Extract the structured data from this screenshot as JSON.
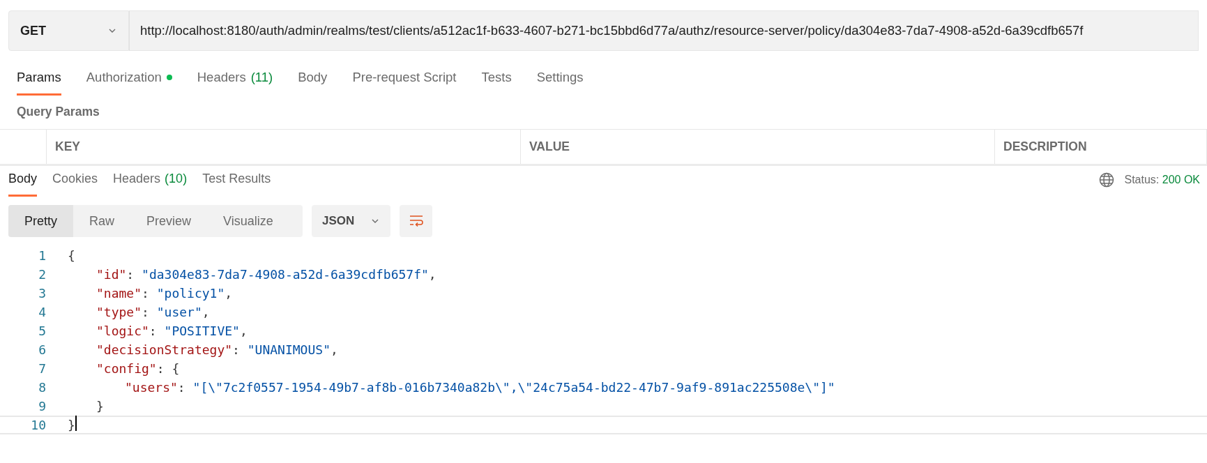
{
  "request": {
    "method": "GET",
    "url": "http://localhost:8180/auth/admin/realms/test/clients/a512ac1f-b633-4607-b271-bc15bbd6d77a/authz/resource-server/policy/da304e83-7da7-4908-a52d-6a39cdfb657f"
  },
  "request_tabs": [
    {
      "label": "Params",
      "selected": true
    },
    {
      "label": "Authorization",
      "selected": false,
      "color": "#0cbb52"
    },
    {
      "label": "Headers",
      "count": "(11)",
      "selected": false
    },
    {
      "label": "Body",
      "selected": false
    },
    {
      "label": "Pre-request Script",
      "selected": false
    },
    {
      "label": "Tests",
      "selected": false
    },
    {
      "label": "Settings",
      "selected": false
    }
  ],
  "query_params": {
    "title": "Query Params",
    "columns": [
      "KEY",
      "VALUE",
      "DESCRIPTION"
    ]
  },
  "response_tabs": [
    {
      "label": "Body",
      "selected": true
    },
    {
      "label": "Cookies",
      "selected": false
    },
    {
      "label": "Headers",
      "count": "(10)",
      "selected": false
    },
    {
      "label": "Test Results",
      "selected": false
    }
  ],
  "status": {
    "label": "Status:",
    "value": "200 OK"
  },
  "view_modes": [
    {
      "label": "Pretty",
      "selected": true
    },
    {
      "label": "Raw",
      "selected": false
    },
    {
      "label": "Preview",
      "selected": false
    },
    {
      "label": "Visualize",
      "selected": false
    }
  ],
  "format": "JSON",
  "code_lines": [
    {
      "number": "1",
      "active": false,
      "tokens": [
        {
          "kind": "punct",
          "text": "{"
        }
      ],
      "children": [
        {
          "number": "2",
          "active": false,
          "tokens": [
            {
              "kind": "key",
              "text": "\"id\""
            },
            {
              "kind": "punct",
              "text": ": "
            },
            {
              "kind": "string",
              "text": "\"da304e83-7da7-4908-a52d-6a39cdfb657f\""
            },
            {
              "kind": "punct",
              "text": ","
            }
          ]
        },
        {
          "number": "3",
          "active": false,
          "tokens": [
            {
              "kind": "key",
              "text": "\"name\""
            },
            {
              "kind": "punct",
              "text": ": "
            },
            {
              "kind": "string",
              "text": "\"policy1\""
            },
            {
              "kind": "punct",
              "text": ","
            }
          ]
        },
        {
          "number": "4",
          "active": false,
          "tokens": [
            {
              "kind": "key",
              "text": "\"type\""
            },
            {
              "kind": "punct",
              "text": ": "
            },
            {
              "kind": "string",
              "text": "\"user\""
            },
            {
              "kind": "punct",
              "text": ","
            }
          ]
        },
        {
          "number": "5",
          "active": false,
          "tokens": [
            {
              "kind": "key",
              "text": "\"logic\""
            },
            {
              "kind": "punct",
              "text": ": "
            },
            {
              "kind": "string",
              "text": "\"POSITIVE\""
            },
            {
              "kind": "punct",
              "text": ","
            }
          ]
        },
        {
          "number": "6",
          "active": false,
          "tokens": [
            {
              "kind": "key",
              "text": "\"decisionStrategy\""
            },
            {
              "kind": "punct",
              "text": ": "
            },
            {
              "kind": "string",
              "text": "\"UNANIMOUS\""
            },
            {
              "kind": "punct",
              "text": ","
            }
          ]
        },
        {
          "number": "7",
          "active": false,
          "tokens": [
            {
              "kind": "key",
              "text": "\"config\""
            },
            {
              "kind": "punct",
              "text": ": {"
            }
          ],
          "children": [
            {
              "number": "8",
              "active": false,
              "tokens": [
                {
                  "kind": "key",
                  "text": "\"users\""
                },
                {
                  "kind": "punct",
                  "text": ": "
                },
                {
                  "kind": "string",
                  "text": "\"[\\\"7c2f0557-1954-49b7-af8b-016b7340a82b\\\",\\\"24c75a54-bd22-47b7-9af9-891ac225508e\\\"]\""
                }
              ]
            }
          ]
        },
        {
          "number": "9",
          "active": false,
          "tokens": [
            {
              "kind": "punct",
              "text": "}"
            }
          ]
        }
      ]
    },
    {
      "number": "10",
      "active": true,
      "tokens": [
        {
          "kind": "punct",
          "text": "}"
        }
      ]
    }
  ]
}
